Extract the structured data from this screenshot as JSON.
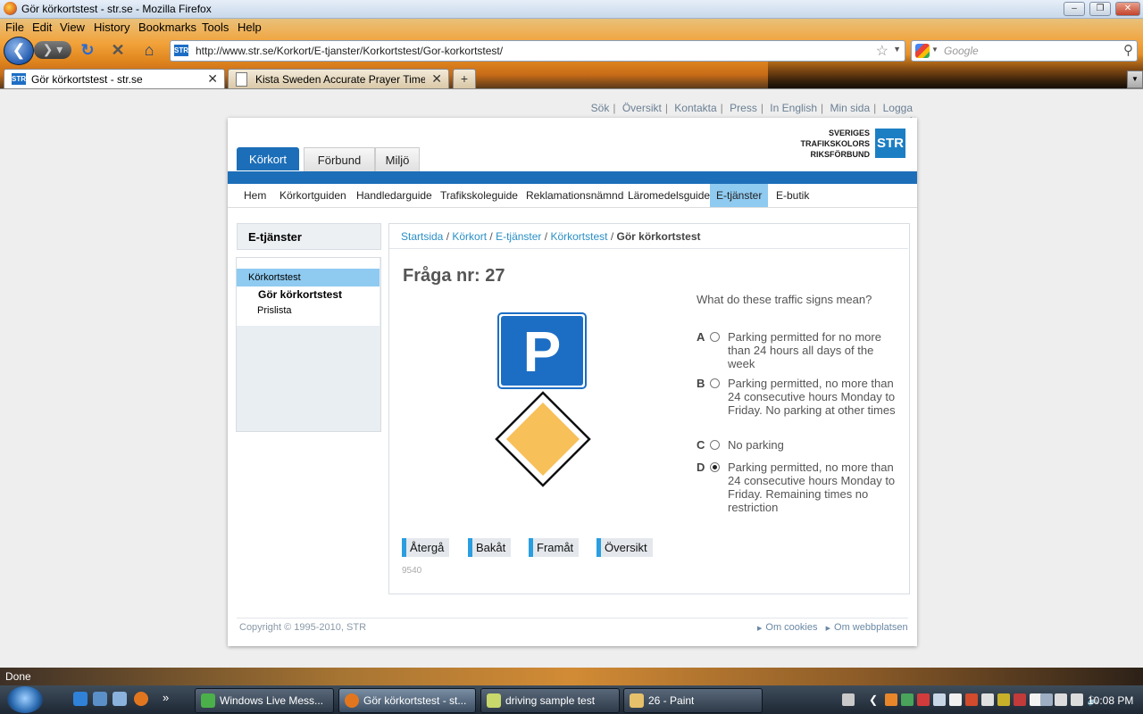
{
  "window": {
    "title": "Gör körkortstest - str.se - Mozilla Firefox"
  },
  "menu": [
    "File",
    "Edit",
    "View",
    "History",
    "Bookmarks",
    "Tools",
    "Help"
  ],
  "browser": {
    "url": "http://www.str.se/Korkort/E-tjanster/Korkortstest/Gor-korkortstest/",
    "search_placeholder": "Google",
    "site_icon_text": "STR",
    "tabs": [
      {
        "label": "Gör körkortstest - str.se",
        "active": true
      },
      {
        "label": "Kista Sweden Accurate Prayer Time...",
        "active": false
      }
    ],
    "new_tab": "+"
  },
  "page": {
    "top_links": [
      "Sök",
      "Översikt",
      "Kontakta",
      "Press",
      "In English",
      "Min sida",
      "Logga ut"
    ],
    "logo": {
      "line1": "SVERIGES",
      "line2": "TRAFIKSKOLORS",
      "line3": "RIKSFÖRBUND",
      "mark": "STR"
    },
    "main_tabs": [
      "Körkort",
      "Förbund",
      "Miljö"
    ],
    "subnav": [
      "Hem",
      "Körkortguiden",
      "Handledarguide",
      "Trafikskoleguide",
      "Reklamationsnämnd",
      "Läromedelsguide",
      "E-tjänster",
      "E-butik"
    ],
    "subnav_active": "E-tjänster",
    "sidebar": {
      "heading": "E-tjänster",
      "items": [
        "Körkortstest",
        "Gör körkortstest",
        "Prislista"
      ]
    },
    "breadcrumb": {
      "links": [
        "Startsida",
        "Körkort",
        "E-tjänster",
        "Körkortstest"
      ],
      "current": "Gör körkortstest"
    },
    "question": {
      "title": "Fråga nr: 27",
      "text": "What do these traffic signs mean?",
      "sign_letter": "P",
      "options": [
        {
          "letter": "A",
          "text": "Parking permitted for no more than 24 hours all days of the week",
          "selected": false
        },
        {
          "letter": "B",
          "text": "Parking permitted, no more than 24 consecutive hours Monday to Friday. No parking at other times",
          "selected": false
        },
        {
          "letter": "C",
          "text": "No parking",
          "selected": false
        },
        {
          "letter": "D",
          "text": "Parking permitted, no more than 24 consecutive hours Monday to Friday. Remaining times no restriction",
          "selected": true
        }
      ]
    },
    "nav_buttons": [
      "Återgå",
      "Bakåt",
      "Framåt",
      "Översikt"
    ],
    "code": "9540",
    "copyright": "Copyright © 1995-2010, STR",
    "footer_links": [
      "Om cookies",
      "Om webbplatsen"
    ]
  },
  "status": "Done",
  "taskbar": {
    "buttons": [
      "Windows Live Mess...",
      "Gör körkortstest - st...",
      "driving sample test",
      "26 - Paint"
    ],
    "overflow": "»",
    "clock": "10:08 PM"
  },
  "colors": {
    "brand_blue": "#1c6eb8",
    "active_light_blue": "#8fcaf0",
    "link_blue": "#2a8fc6",
    "sign_blue": "#1c6ec4",
    "sign_yellow": "#f8c059"
  }
}
